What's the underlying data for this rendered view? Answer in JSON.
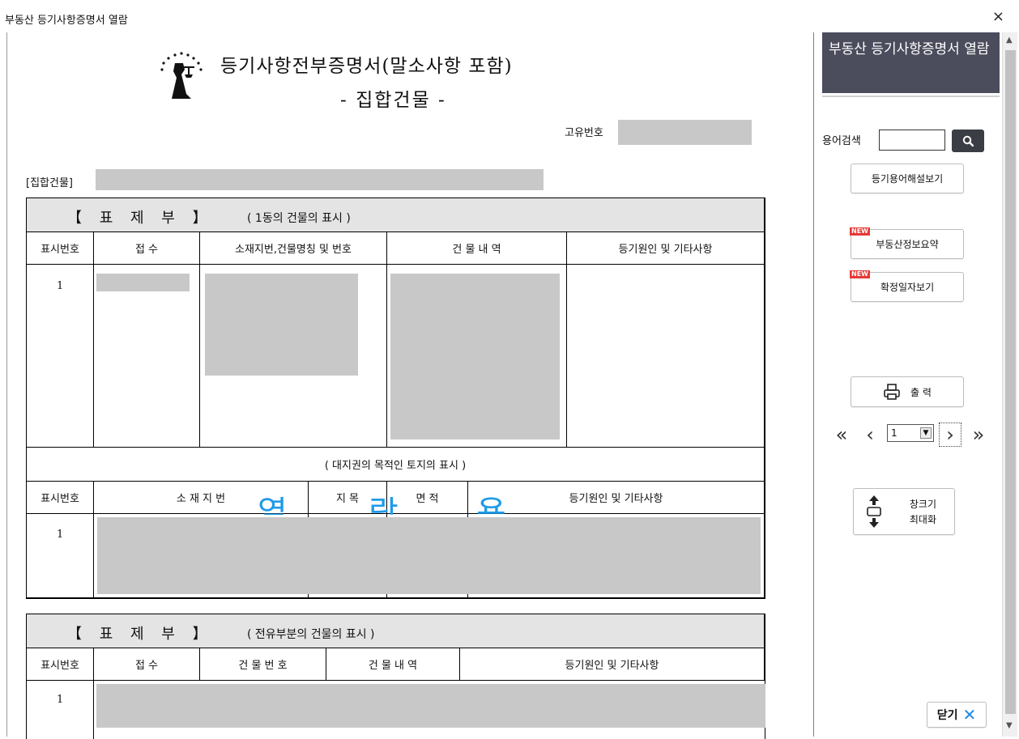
{
  "window": {
    "title": "부동산 등기사항증명서 열람",
    "close_icon": "×"
  },
  "document": {
    "title": "등기사항전부증명서(말소사항 포함)",
    "subtitle": "- 집합건물 -",
    "unique_number_label": "고유번호",
    "building_label": "[집합건물]",
    "watermark": [
      "열",
      "람",
      "용"
    ],
    "section1": {
      "title": "【 표 제 부 】",
      "subtitle": "( 1동의 건물의 표시 )",
      "headers": [
        "표시번호",
        "접 수",
        "소재지번,건물명칭 및 번호",
        "건 물 내 역",
        "등기원인 및 기타사항"
      ],
      "row_number": "1"
    },
    "land_section": {
      "title": "( 대지권의 목적인 토지의 표시 )",
      "headers": [
        "표시번호",
        "소 재 지 번",
        "지 목",
        "면 적",
        "등기원인 및 기타사항"
      ],
      "row_number": "1"
    },
    "section2": {
      "title": "【 표 제 부 】",
      "subtitle": "( 전유부분의 건물의 표시 )",
      "headers": [
        "표시번호",
        "접 수",
        "건 물 번 호",
        "건 물 내 역",
        "등기원인 및 기타사항"
      ],
      "row_number": "1"
    }
  },
  "panel": {
    "header": "부동산 등기사항증명서 열람",
    "search_label": "용어검색",
    "search_value": "",
    "glossary_button": "등기용어해설보기",
    "summary_button": "부동산정보요약",
    "date_button": "확정일자보기",
    "new_badge": "NEW",
    "print_button": "출 력",
    "page_value": "1",
    "maximize_button": [
      "창크기",
      "최대화"
    ],
    "close_button": "닫기"
  },
  "colors": {
    "panel_header": "#4b4c5c",
    "redacted": "#c8c8c8",
    "watermark": "#1e9be8",
    "badge": "#e53935",
    "close_x": "#1e88e5"
  }
}
